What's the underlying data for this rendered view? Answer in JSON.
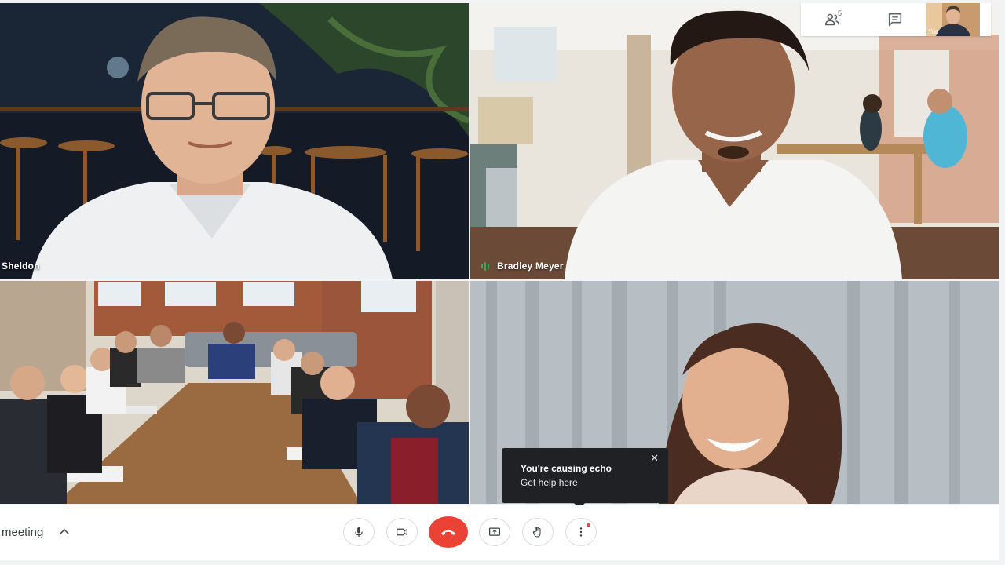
{
  "participants": {
    "top_left": {
      "name": "Sheldon"
    },
    "top_right": {
      "name": "Bradley Meyer"
    }
  },
  "top_panel": {
    "people_count": "5",
    "self_label": "You",
    "icons": [
      "people-icon",
      "chat-icon"
    ]
  },
  "echo_tooltip": {
    "title": "You're causing echo",
    "link": "Get help here",
    "close": "✕"
  },
  "bottom_bar": {
    "meeting_label": "meeting",
    "controls": [
      "mic-icon",
      "camera-icon",
      "end-call-icon",
      "present-icon",
      "raise-hand-icon",
      "more-options-icon"
    ]
  },
  "colors": {
    "end_call": "#ea4335",
    "speaking": "#34a853",
    "tooltip_bg": "#202124"
  }
}
